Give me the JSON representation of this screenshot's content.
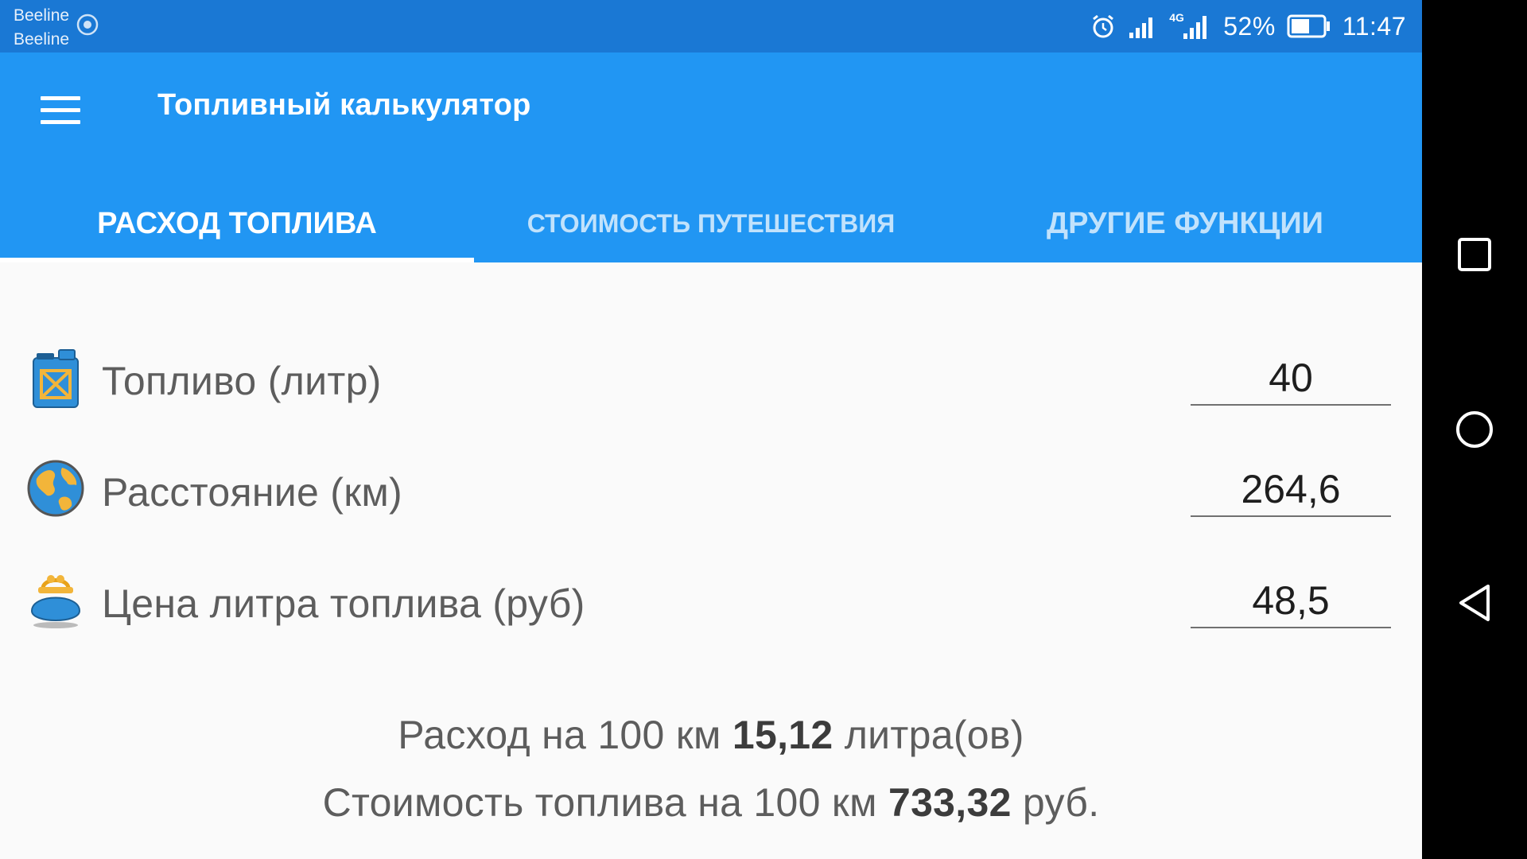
{
  "status_bar": {
    "carrier1": "Beeline",
    "carrier2": "Beeline",
    "network": "4G",
    "battery": "52%",
    "time": "11:47",
    "icons": [
      "alarm-icon",
      "signal-icon",
      "signal-4g-icon",
      "battery-icon"
    ]
  },
  "app_bar": {
    "title": "Топливный калькулятор",
    "menu_icon": "hamburger-menu-icon",
    "color": "#2196f3"
  },
  "tabs": [
    {
      "label": "РАСХОД ТОПЛИВА",
      "active": true
    },
    {
      "label": "СТОИМОСТЬ ПУТЕШЕСТВИЯ",
      "active": false
    },
    {
      "label": "ДРУГИЕ ФУНКЦИИ",
      "active": false
    }
  ],
  "fields": [
    {
      "icon": "fuel-canister-icon",
      "label": "Топливо (литр)",
      "value": "40"
    },
    {
      "icon": "globe-icon",
      "label": "Расстояние (км)",
      "value": "264,6"
    },
    {
      "icon": "purse-icon",
      "label": "Цена литра топлива (руб)",
      "value": "48,5"
    }
  ],
  "results": {
    "consumption_prefix": "Расход на 100 км ",
    "consumption_value": "15,12",
    "consumption_suffix": " литра(ов)",
    "cost_prefix": "Стоимость топлива на 100 км ",
    "cost_value": "733,32",
    "cost_suffix": " руб."
  },
  "nav_bar": {
    "icons": [
      "recents-square-icon",
      "home-circle-icon",
      "back-triangle-icon"
    ]
  }
}
